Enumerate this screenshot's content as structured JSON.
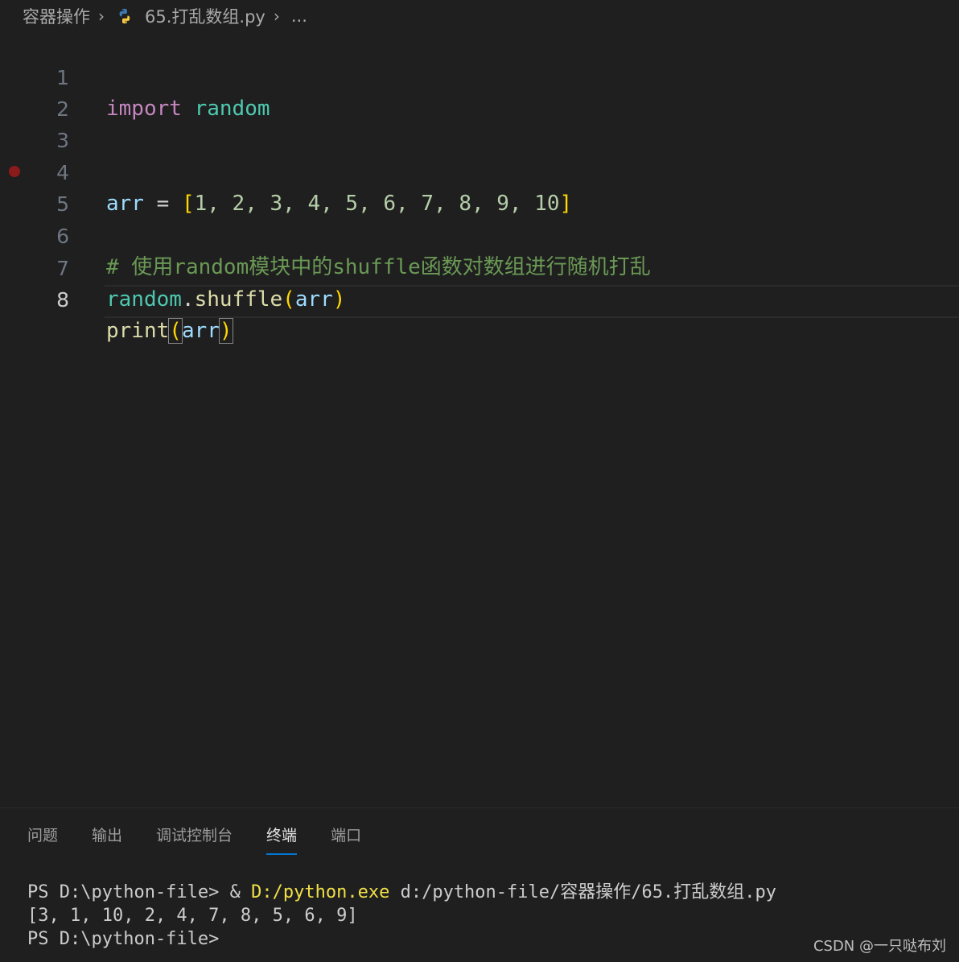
{
  "breadcrumb": {
    "folder": "容器操作",
    "file": "65.打乱数组.py",
    "more": "..."
  },
  "editor": {
    "line_numbers": [
      "1",
      "2",
      "3",
      "4",
      "5",
      "6",
      "7",
      "8"
    ],
    "active_line": 8,
    "breakpoint_line": 4,
    "code": {
      "l1_kw": "import",
      "l1_mod": "random",
      "l4_var": "arr",
      "l4_eq": "=",
      "l4_open": "[",
      "l4_items": "1, 2, 3, 4, 5, 6, 7, 8, 9, 10",
      "l4_close": "]",
      "l6_comment": "# 使用random模块中的shuffle函数对数组进行随机打乱",
      "l7_mod": "random",
      "l7_dot": ".",
      "l7_fn": "shuffle",
      "l7_open": "(",
      "l7_arg": "arr",
      "l7_close": ")",
      "l8_fn": "print",
      "l8_open": "(",
      "l8_arg": "arr",
      "l8_close": ")"
    }
  },
  "panel": {
    "tabs": [
      "问题",
      "输出",
      "调试控制台",
      "终端",
      "端口"
    ],
    "active_tab": "终端",
    "terminal": {
      "line1_prompt": "PS D:\\python-file> & ",
      "line1_exe": "D:/python.exe",
      "line1_arg": " d:/python-file/容器操作/65.打乱数组.py",
      "line2": "[3, 1, 10, 2, 4, 7, 8, 5, 6, 9]",
      "line3": "PS D:\\python-file>"
    }
  },
  "watermark": "CSDN @一只哒布刘",
  "colors": {
    "background": "#1f1f1f",
    "keyword": "#c586c0",
    "module": "#4ec9b0",
    "variable": "#9cdcfe",
    "number": "#b5cea8",
    "function": "#dcdcaa",
    "comment": "#6a9955",
    "bracket": "#ffd700",
    "terminal_command": "#f0e046",
    "breakpoint": "#8b1a1a",
    "active_tab_underline": "#0078d4"
  }
}
